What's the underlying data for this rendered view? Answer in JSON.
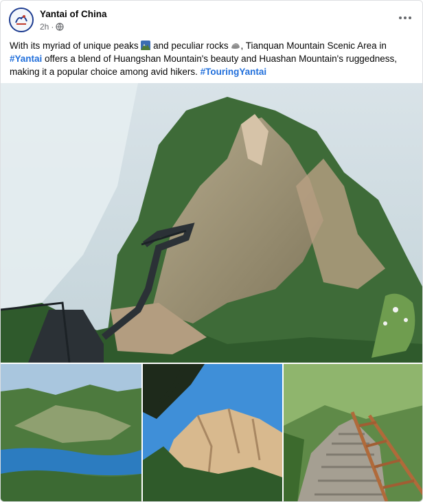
{
  "post": {
    "page_name": "Yantai of China",
    "time": "2h",
    "separator": "·",
    "caption": {
      "part1": "With its myriad of unique peaks",
      "part2": "and peculiar rocks",
      "part3": ", Tianquan Mountain Scenic Area in",
      "hashtag1": "#Yantai",
      "part4": "offers a blend of Huangshan Mountain's beauty and Huashan Mountain's ruggedness, making it a popular choice among avid hikers.",
      "hashtag2": "#TouringYantai"
    }
  },
  "icons": {
    "more": "more-options-icon",
    "privacy": "globe-icon",
    "emoji1": "mountain-emoji-icon",
    "emoji2": "rock-emoji-icon"
  },
  "colors": {
    "text": "#050505",
    "secondary": "#65676b",
    "link": "#216fdb"
  },
  "photos": [
    {
      "subject": "misty mountain peak with boardwalk"
    },
    {
      "subject": "reservoir among green hills"
    },
    {
      "subject": "rocky cliff under blue sky"
    },
    {
      "subject": "stone stairway with wooden railing"
    }
  ]
}
